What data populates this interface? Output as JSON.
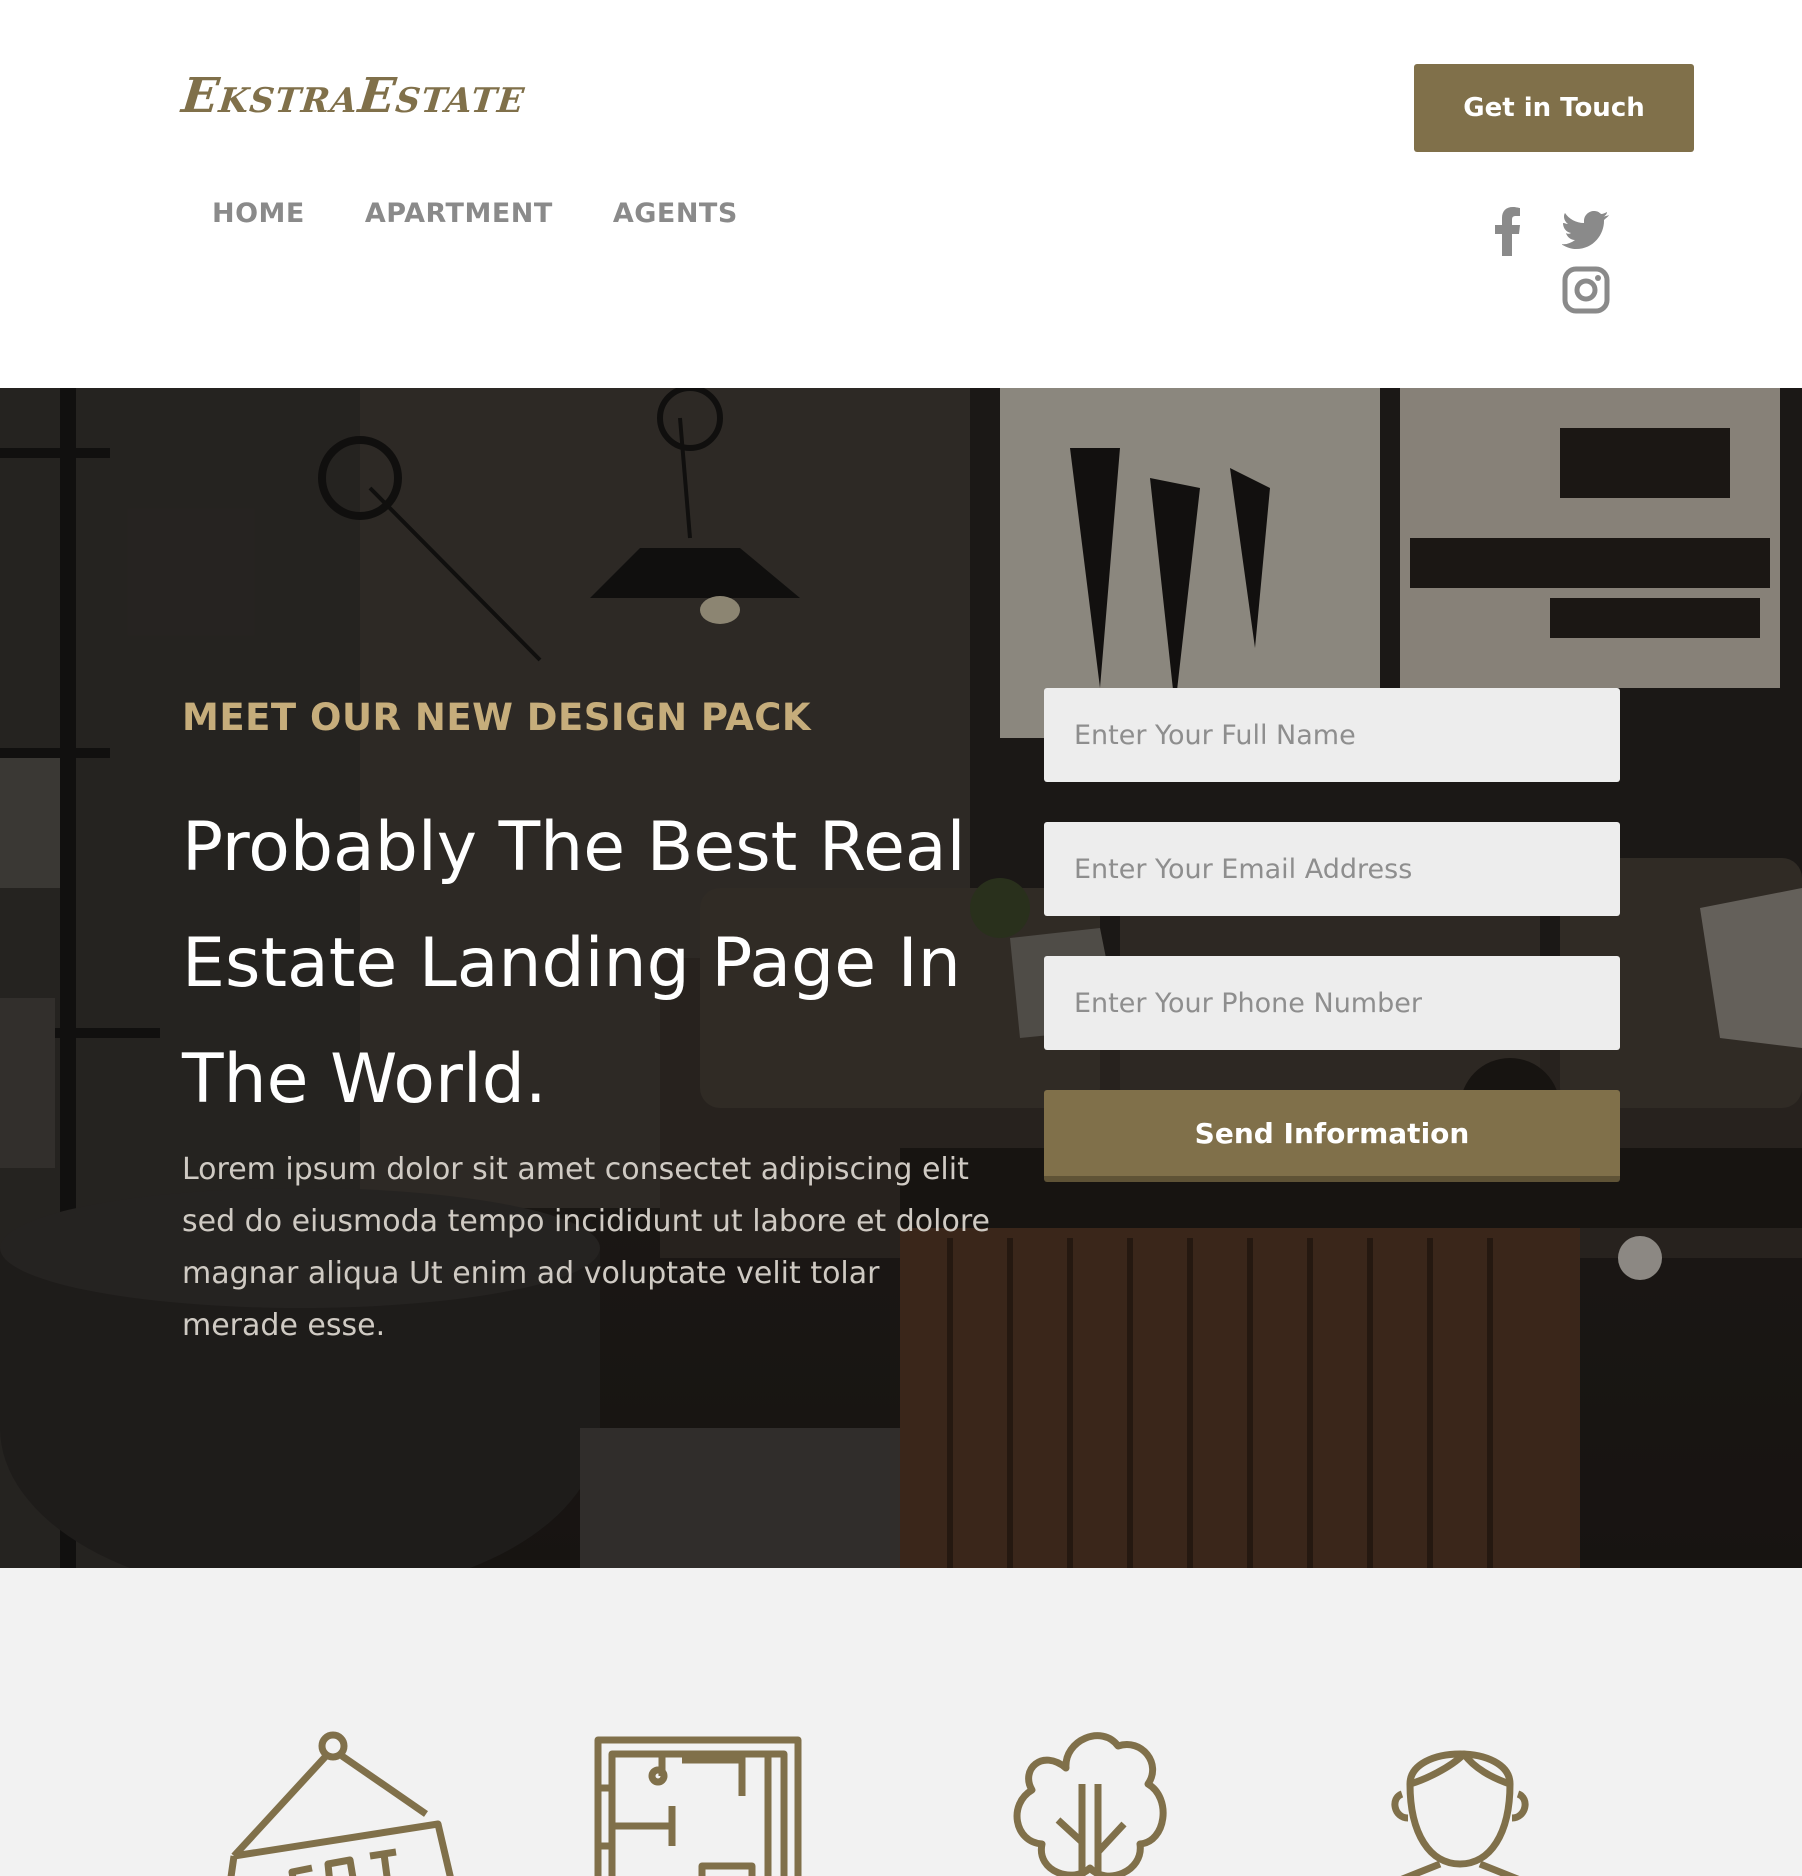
{
  "header": {
    "logo": "EkstraEstate",
    "cta_label": "Get in Touch",
    "nav": [
      {
        "label": "HOME"
      },
      {
        "label": "APARTMENT"
      },
      {
        "label": "AGENTS"
      }
    ],
    "social": [
      "facebook-icon",
      "twitter-icon",
      "instagram-icon"
    ]
  },
  "hero": {
    "eyebrow": "MEET OUR NEW DESIGN PACK",
    "headline": "Probably The Best Real Estate Landing Page In The World.",
    "body": "Lorem ipsum dolor sit amet consectet adipiscing elit sed do eiusmoda tempo incididunt ut labore et dolore magnar aliqua Ut enim ad voluptate velit tolar merade esse."
  },
  "form": {
    "name_placeholder": "Enter Your Full Name",
    "email_placeholder": "Enter Your Email Address",
    "phone_placeholder": "Enter Your Phone Number",
    "submit_label": "Send Information"
  },
  "features": {
    "icons": [
      "rent-sign-icon",
      "floor-plan-icon",
      "tree-icon",
      "agent-icon"
    ]
  },
  "colors": {
    "accent": "#80704a",
    "eyebrow": "#c6ad7b",
    "nav_text": "#8a8a8a",
    "features_bg": "#f2f2f2"
  }
}
